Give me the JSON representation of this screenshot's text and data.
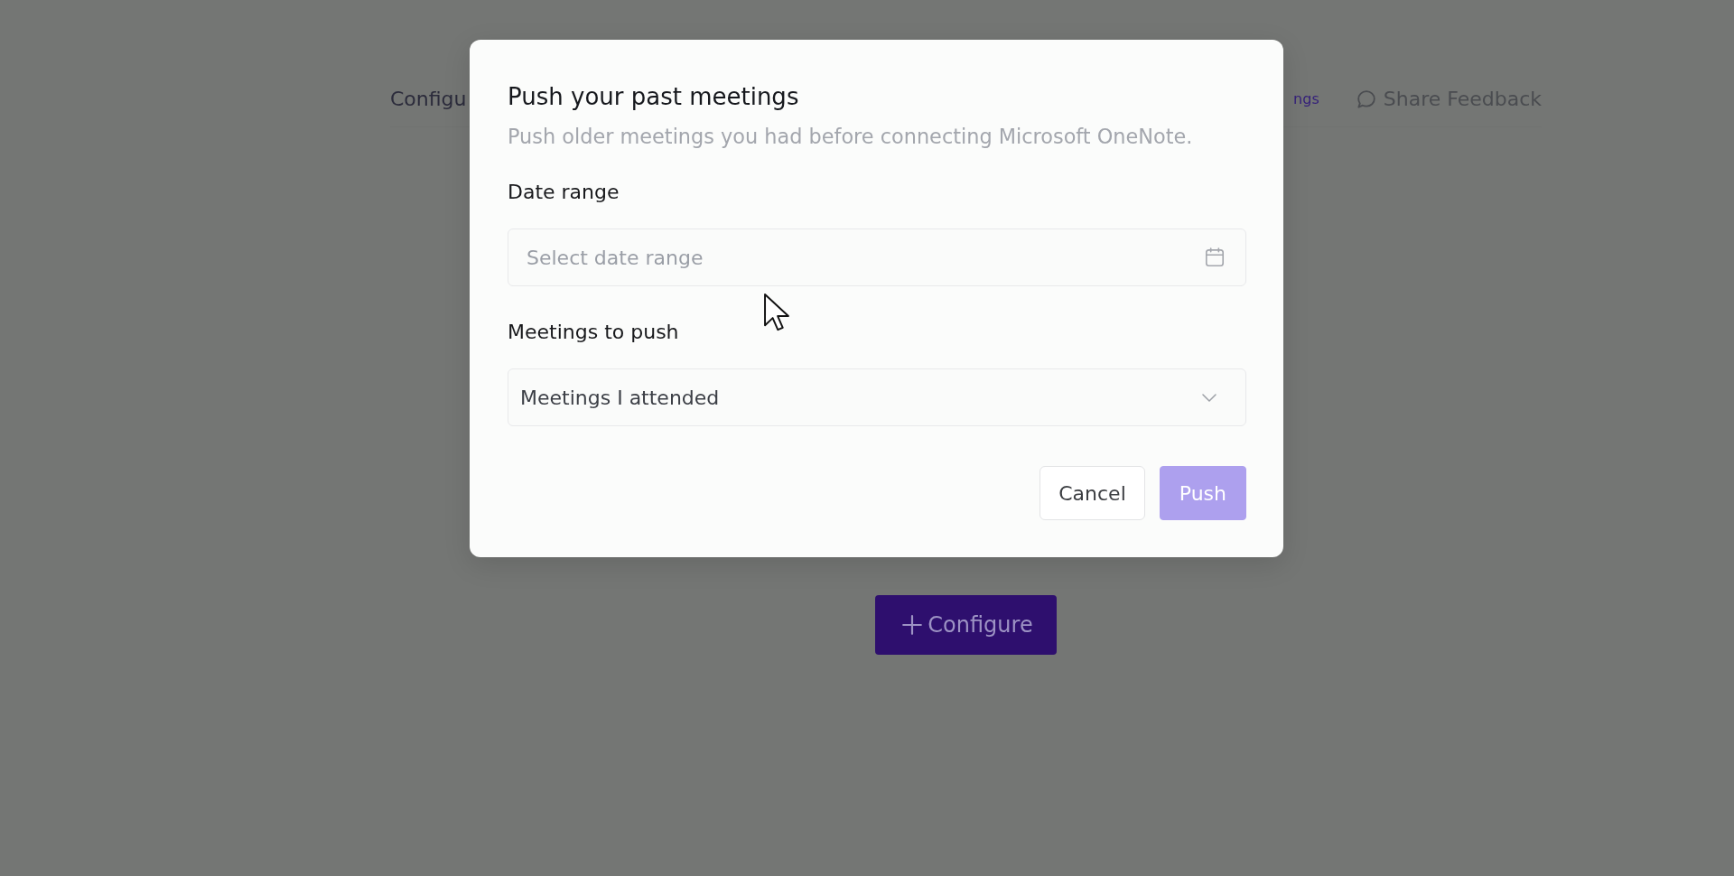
{
  "header": {
    "title": "Configu",
    "tabs": [
      {
        "label": "ngs",
        "selected": true
      }
    ],
    "feedback": {
      "label": "Share Feedback"
    }
  },
  "main": {
    "configure_button": {
      "label": "Configure"
    }
  },
  "dialog": {
    "title": "Push your past meetings",
    "subtitle": "Push older meetings you had before connecting Microsoft OneNote.",
    "fields": [
      {
        "kind": "date",
        "label": "Date range",
        "placeholder": "Select date range"
      },
      {
        "kind": "select",
        "label": "Meetings to push",
        "value": "Meetings I attended"
      }
    ],
    "buttons": [
      {
        "kind": "secondary",
        "label": "Cancel",
        "disabled": false
      },
      {
        "kind": "primary",
        "label": "Push",
        "disabled": true
      }
    ]
  }
}
